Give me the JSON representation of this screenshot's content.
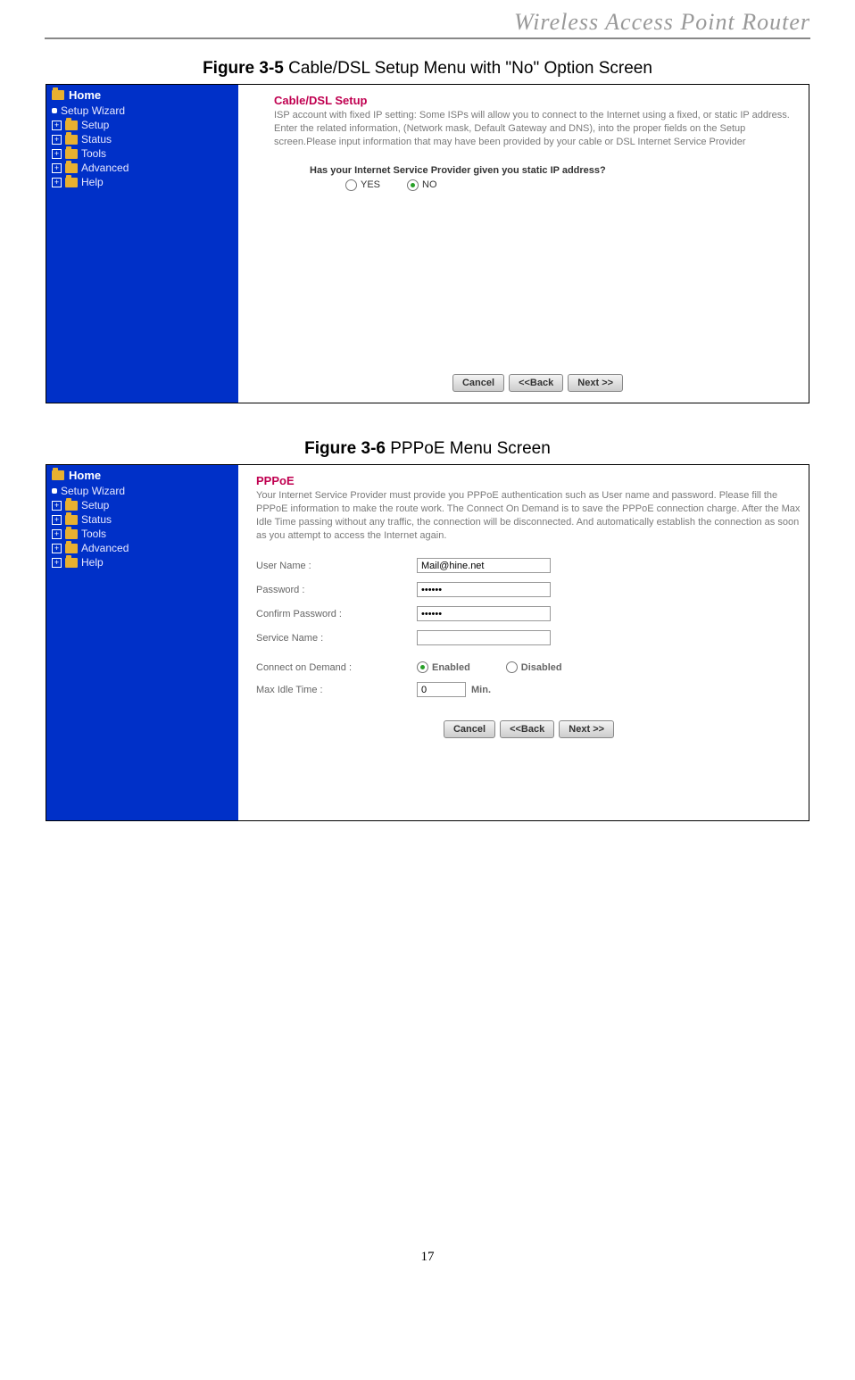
{
  "header": {
    "banner": "Wireless  Access  Point  Router"
  },
  "captions": {
    "fig35_bold": "Figure 3-5",
    "fig35_rest": " Cable/DSL Setup Menu with \"No\" Option Screen",
    "fig36_bold": "Figure 3-6",
    "fig36_rest": " PPPoE Menu Screen"
  },
  "sidebar": {
    "home": "Home",
    "items": [
      "Setup Wizard",
      "Setup",
      "Status",
      "Tools",
      "Advanced",
      "Help"
    ]
  },
  "s35": {
    "title": "Cable/DSL Setup",
    "desc": "ISP account with fixed IP setting: Some ISPs will allow you to connect to the Internet using a fixed, or static IP address. Enter the related information, (Network mask, Default Gateway and DNS), into the proper fields on the Setup screen.Please input information that may have been provided by your cable or DSL Internet Service Provider",
    "question": "Has your Internet Service Provider given you static IP address?",
    "yes": "YES",
    "no": "NO"
  },
  "s36": {
    "title": "PPPoE",
    "desc": "Your Internet Service Provider must provide you PPPoE authentication such as User name and password. Please fill the PPPoE information to make the route work. The Connect On Demand is to save the PPPoE connection charge. After the Max Idle Time passing without any traffic, the connection will be disconnected. And automatically establish the connection as soon as you attempt to access the Internet again.",
    "labels": {
      "user": "User Name :",
      "pass": "Password :",
      "cpass": "Confirm Password :",
      "svc": "Service Name :",
      "cod": "Connect on Demand :",
      "idle": "Max Idle Time :",
      "min": "Min."
    },
    "values": {
      "user": "Mail@hine.net",
      "pass": "••••••",
      "cpass": "••••••",
      "svc": "",
      "idle": "0"
    },
    "enabled": "Enabled",
    "disabled": "Disabled"
  },
  "buttons": {
    "cancel": "Cancel",
    "back": "<<Back",
    "next": "Next >>"
  },
  "page_number": "17"
}
